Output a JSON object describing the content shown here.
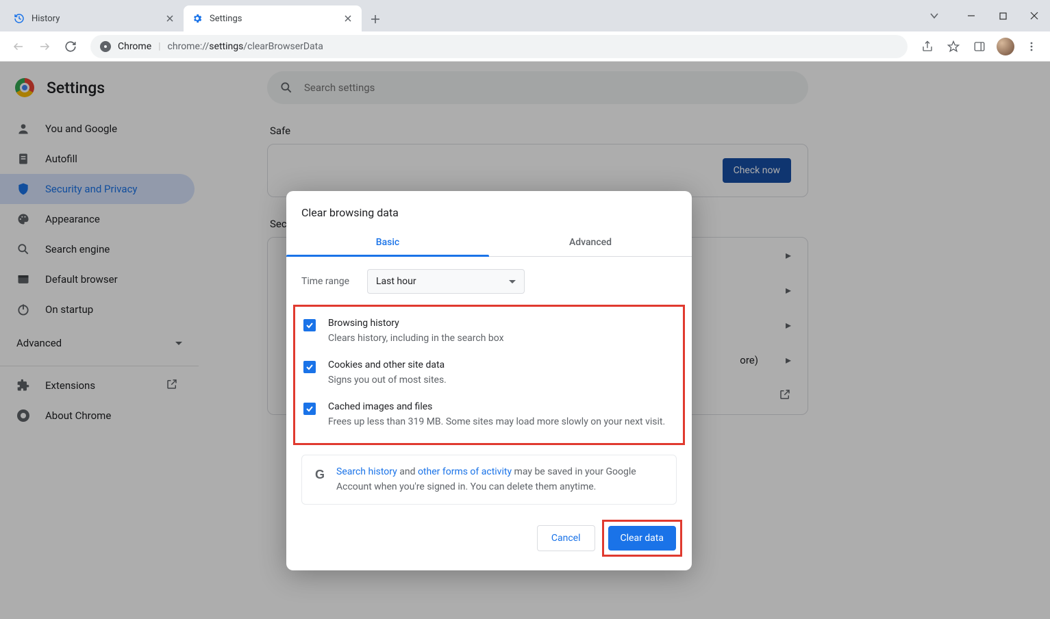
{
  "tabs": [
    {
      "title": "History"
    },
    {
      "title": "Settings"
    }
  ],
  "address": {
    "scheme_label": "Chrome",
    "scheme": "chrome://",
    "host": "settings",
    "path": "/clearBrowserData"
  },
  "sidebar": {
    "title": "Settings",
    "items": [
      "You and Google",
      "Autofill",
      "Security and Privacy",
      "Appearance",
      "Search engine",
      "Default browser",
      "On startup"
    ],
    "advanced": "Advanced",
    "extensions": "Extensions",
    "about": "About Chrome"
  },
  "main": {
    "search_placeholder": "Search settings",
    "safety_label_partial": "Safe",
    "check_now": "Check now",
    "security_label_partial": "Secu",
    "more_fragment": "ore)"
  },
  "dialog": {
    "title": "Clear browsing data",
    "tab_basic": "Basic",
    "tab_advanced": "Advanced",
    "time_range_label": "Time range",
    "time_range_value": "Last hour",
    "items": [
      {
        "title": "Browsing history",
        "desc": "Clears history, including in the search box"
      },
      {
        "title": "Cookies and other site data",
        "desc": "Signs you out of most sites."
      },
      {
        "title": "Cached images and files",
        "desc": "Frees up less than 319 MB. Some sites may load more slowly on your next visit."
      }
    ],
    "info": {
      "link1": "Search history",
      "mid": " and ",
      "link2": "other forms of activity",
      "rest": " may be saved in your Google Account when you're signed in. You can delete them anytime."
    },
    "cancel": "Cancel",
    "clear": "Clear data"
  }
}
